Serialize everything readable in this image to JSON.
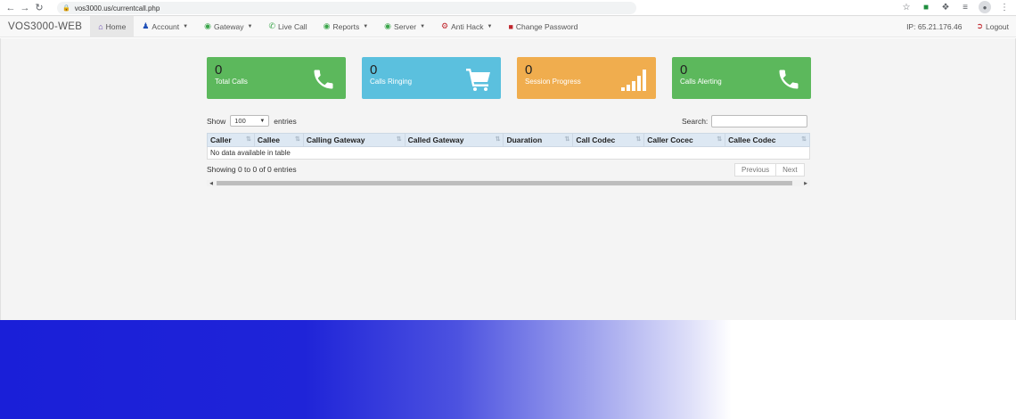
{
  "browser": {
    "url": "vos3000.us/currentcall.php"
  },
  "navbar": {
    "brand": "VOS3000-WEB",
    "items": [
      {
        "label": "Home",
        "icon": "home-icon",
        "dropdown": false,
        "active": true
      },
      {
        "label": "Account",
        "icon": "user-icon",
        "dropdown": true
      },
      {
        "label": "Gateway",
        "icon": "globe-icon",
        "dropdown": true
      },
      {
        "label": "Live Call",
        "icon": "phone-icon",
        "dropdown": false
      },
      {
        "label": "Reports",
        "icon": "globe-icon",
        "dropdown": true
      },
      {
        "label": "Server",
        "icon": "globe-icon",
        "dropdown": true
      },
      {
        "label": "Anti Hack",
        "icon": "cog-icon",
        "dropdown": true
      },
      {
        "label": "Change Password",
        "icon": "lock-icon",
        "dropdown": false
      }
    ],
    "ip_label": "IP: 65.21.176.46",
    "logout_label": "Logout"
  },
  "cards": [
    {
      "value": "0",
      "label": "Total Calls",
      "icon": "phone-icon",
      "color": "#5cb85c"
    },
    {
      "value": "0",
      "label": "Calls Ringing",
      "icon": "cart-icon",
      "color": "#5bc0de"
    },
    {
      "value": "0",
      "label": "Session Progress",
      "icon": "signal-icon",
      "color": "#f0ad4e"
    },
    {
      "value": "0",
      "label": "Calls Alerting",
      "icon": "phone-icon",
      "color": "#5cb85c"
    }
  ],
  "table": {
    "show_label": "Show",
    "entries_value": "100",
    "entries_label": "entries",
    "search_label": "Search:",
    "search_value": "",
    "columns": [
      "Caller",
      "Callee",
      "Calling Gateway",
      "Called Gateway",
      "Duaration",
      "Call Codec",
      "Caller Cocec",
      "Callee Codec"
    ],
    "empty_message": "No data available in table",
    "info": "Showing 0 to 0 of 0 entries",
    "prev_label": "Previous",
    "next_label": "Next"
  }
}
